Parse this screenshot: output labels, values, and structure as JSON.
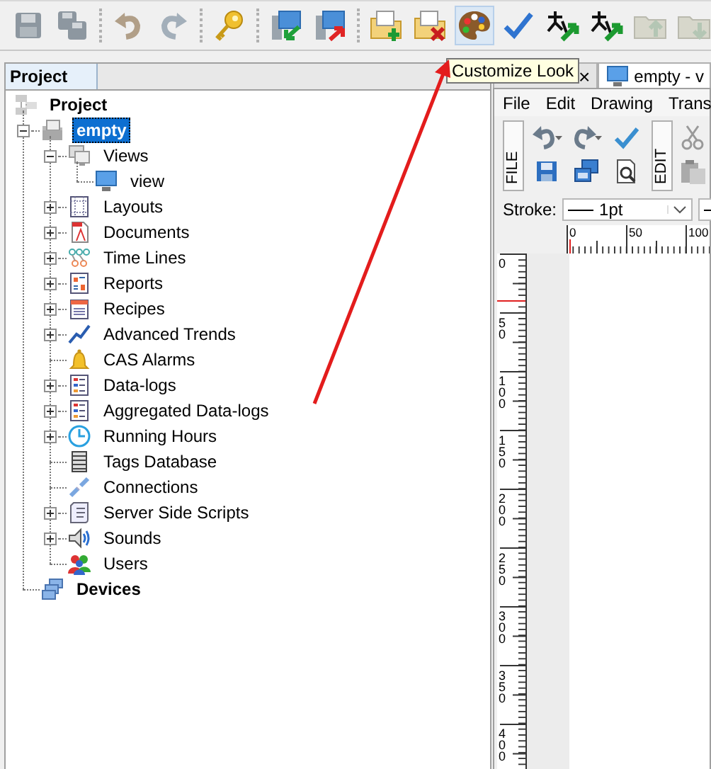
{
  "toolbar": [
    {
      "buttons": [
        {
          "kind": "save",
          "disabled": true,
          "selected": false
        },
        {
          "kind": "save-all",
          "disabled": true,
          "selected": false
        }
      ]
    },
    {
      "buttons": [
        {
          "kind": "undo",
          "disabled": true,
          "selected": false
        },
        {
          "kind": "redo",
          "disabled": true,
          "selected": false
        }
      ]
    },
    {
      "buttons": [
        {
          "kind": "key",
          "disabled": false,
          "selected": false
        }
      ]
    },
    {
      "buttons": [
        {
          "kind": "import",
          "disabled": false,
          "selected": false
        },
        {
          "kind": "export",
          "disabled": false,
          "selected": false
        }
      ]
    },
    {
      "buttons": [
        {
          "kind": "folder-add",
          "disabled": false,
          "selected": false
        },
        {
          "kind": "folder-remove",
          "disabled": false,
          "selected": false
        },
        {
          "kind": "palette",
          "disabled": false,
          "selected": true
        },
        {
          "kind": "check",
          "disabled": false,
          "selected": false
        },
        {
          "kind": "translate",
          "disabled": false,
          "selected": false
        },
        {
          "kind": "translate",
          "disabled": false,
          "selected": false
        },
        {
          "kind": "folder-up",
          "disabled": true,
          "selected": false
        },
        {
          "kind": "folder-down",
          "disabled": true,
          "selected": false
        }
      ]
    }
  ],
  "tooltip": "Customize Look",
  "project_panel": {
    "title": "Project",
    "tree": [
      {
        "label": "Project",
        "kind": "project",
        "bold": true,
        "selected": false,
        "children": [
          {
            "label": "empty",
            "kind": "folder",
            "bold": true,
            "selected": true,
            "expanded": true,
            "children": [
              {
                "label": "Views",
                "kind": "views",
                "bold": false,
                "selected": false,
                "expanded": true,
                "children": [
                  {
                    "label": "view",
                    "kind": "view",
                    "bold": false,
                    "selected": false
                  }
                ]
              },
              {
                "label": "Layouts",
                "kind": "layouts",
                "bold": false,
                "selected": false,
                "expanded": false
              },
              {
                "label": "Documents",
                "kind": "documents",
                "bold": false,
                "selected": false,
                "expanded": false
              },
              {
                "label": "Time Lines",
                "kind": "timelines",
                "bold": false,
                "selected": false,
                "expanded": false
              },
              {
                "label": "Reports",
                "kind": "reports",
                "bold": false,
                "selected": false,
                "expanded": false
              },
              {
                "label": "Recipes",
                "kind": "recipes",
                "bold": false,
                "selected": false,
                "expanded": false
              },
              {
                "label": "Advanced Trends",
                "kind": "trends",
                "bold": false,
                "selected": false,
                "expanded": false
              },
              {
                "label": "CAS Alarms",
                "kind": "alarms",
                "bold": false,
                "selected": false
              },
              {
                "label": "Data-logs",
                "kind": "datalogs",
                "bold": false,
                "selected": false,
                "expanded": false
              },
              {
                "label": "Aggregated Data-logs",
                "kind": "datalogs",
                "bold": false,
                "selected": false,
                "expanded": false
              },
              {
                "label": "Running Hours",
                "kind": "clock",
                "bold": false,
                "selected": false,
                "expanded": false
              },
              {
                "label": "Tags Database",
                "kind": "database",
                "bold": false,
                "selected": false
              },
              {
                "label": "Connections",
                "kind": "connections",
                "bold": false,
                "selected": false
              },
              {
                "label": "Server Side Scripts",
                "kind": "scripts",
                "bold": false,
                "selected": false,
                "expanded": false
              },
              {
                "label": "Sounds",
                "kind": "sounds",
                "bold": false,
                "selected": false,
                "expanded": false
              },
              {
                "label": "Users",
                "kind": "users",
                "bold": false,
                "selected": false
              }
            ]
          },
          {
            "label": "Devices",
            "kind": "devices",
            "bold": true,
            "selected": false
          }
        ]
      }
    ]
  },
  "editor": {
    "tabs": [
      {
        "close": "×",
        "selected": false
      },
      {
        "label": "empty - v",
        "selected": true
      }
    ],
    "menu": [
      "File",
      "Edit",
      "Drawing",
      "Trans"
    ],
    "tool_groups": [
      {
        "label": "FILE",
        "buttons": [
          {
            "kind": "undo"
          },
          {
            "kind": "redo"
          },
          {
            "kind": "check"
          },
          {
            "kind": "save"
          },
          {
            "kind": "windows"
          },
          {
            "kind": "preview"
          }
        ]
      },
      {
        "label": "EDIT",
        "buttons": [
          {
            "kind": "cut"
          },
          {
            "kind": "paste"
          }
        ]
      }
    ],
    "stroke": {
      "label": "Stroke:",
      "value": "1pt"
    },
    "hruler": [
      "0",
      "50",
      "100"
    ],
    "vruler": [
      "0",
      "50",
      "100",
      "150",
      "200",
      "250",
      "300",
      "350",
      "400"
    ]
  }
}
